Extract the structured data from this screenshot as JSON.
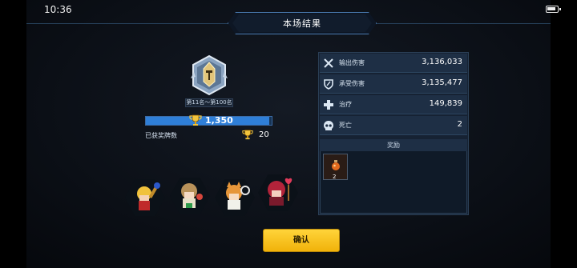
{
  "status_bar": {
    "time": "10:36"
  },
  "header": {
    "title": "本场结果"
  },
  "rank": {
    "label": "第11名～第100名"
  },
  "progress": {
    "value_text": "1,350",
    "fill_fraction": 0.98
  },
  "earned": {
    "label": "已获奖牌数",
    "value": "20"
  },
  "characters": [
    {
      "name": "hero-1"
    },
    {
      "name": "hero-2"
    },
    {
      "name": "hero-3"
    },
    {
      "name": "hero-4"
    }
  ],
  "stats": [
    {
      "icon": "swords-icon",
      "label": "输出伤害",
      "value": "3,136,033"
    },
    {
      "icon": "shield-icon",
      "label": "承受伤害",
      "value": "3,135,477"
    },
    {
      "icon": "heal-cross-icon",
      "label": "治疗",
      "value": "149,839"
    },
    {
      "icon": "skull-icon",
      "label": "死亡",
      "value": "2"
    }
  ],
  "rewards": {
    "header": "奖励",
    "items": [
      {
        "icon": "potion-icon",
        "count": "2"
      }
    ]
  },
  "confirm_label": "确认",
  "colors": {
    "accent_yellow": "#f1b20a",
    "progress_blue": "#2f7fd8",
    "panel": "#162233"
  }
}
